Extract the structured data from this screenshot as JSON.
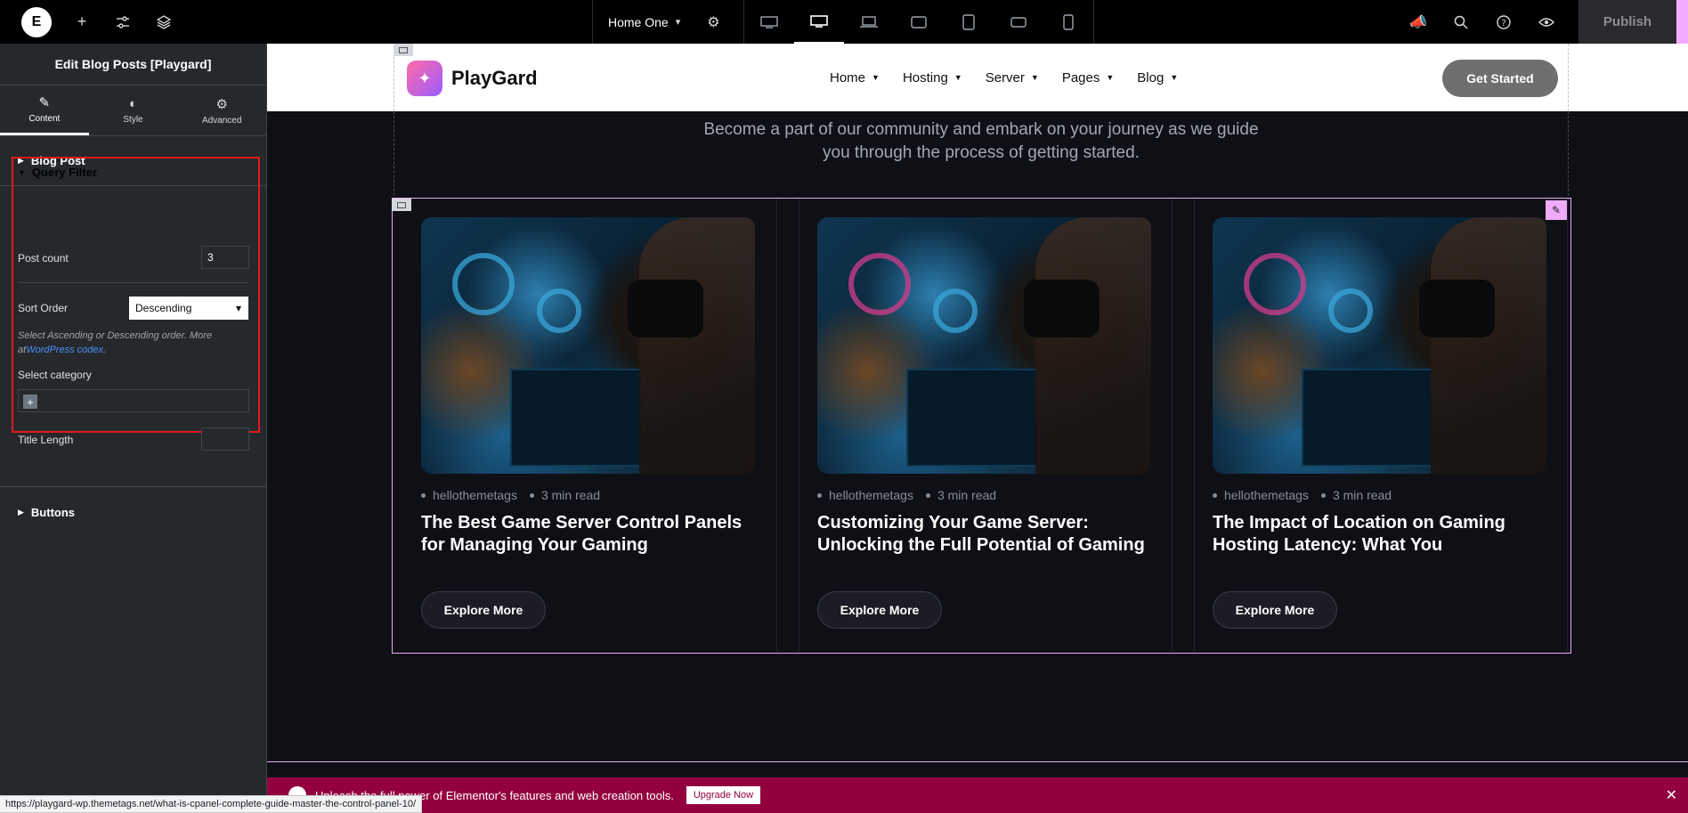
{
  "topbar": {
    "page_name": "Home One",
    "publish_label": "Publish",
    "devices": [
      "desktop",
      "tablet-landscape",
      "laptop",
      "tablet-wide",
      "tablet",
      "mobile-landscape",
      "mobile"
    ]
  },
  "sidebar": {
    "title": "Edit Blog Posts [Playgard]",
    "tabs": [
      {
        "label": "Content",
        "icon": "pencil-icon"
      },
      {
        "label": "Style",
        "icon": "half-circle-icon"
      },
      {
        "label": "Advanced",
        "icon": "gear-icon"
      }
    ],
    "sections": {
      "blog_post": "Blog Post",
      "query_filter": "Query Filter",
      "buttons": "Buttons"
    },
    "controls": {
      "post_count_label": "Post count",
      "post_count_value": "3",
      "sort_order_label": "Sort Order",
      "sort_order_value": "Descending",
      "helper_text": "Select Ascending or Descending order. More at",
      "helper_link": "WordPress codex",
      "helper_tail": ".",
      "category_label": "Select category",
      "title_length_label": "Title Length",
      "title_length_value": ""
    }
  },
  "site": {
    "brand": "PlayGard",
    "nav": [
      "Home",
      "Hosting",
      "Server",
      "Pages",
      "Blog"
    ],
    "cta": "Get Started",
    "intro_line1": "Become a part of our community and embark on your journey as we guide",
    "intro_line2": "you through the process of getting started."
  },
  "posts": [
    {
      "author": "hellothemetags",
      "read_time": "3 min read",
      "title": "The Best Game Server Control Panels for Managing Your Gaming",
      "button": "Explore More"
    },
    {
      "author": "hellothemetags",
      "read_time": "3 min read",
      "title": "Customizing Your Game Server: Unlocking the Full Potential of Gaming",
      "button": "Explore More"
    },
    {
      "author": "hellothemetags",
      "read_time": "3 min read",
      "title": "The Impact of Location on Gaming Hosting Latency: What You",
      "button": "Explore More"
    }
  ],
  "promo": {
    "text": "Unleash the full power of Elementor's features and web creation tools.",
    "button": "Upgrade Now"
  },
  "status_url": "https://playgard-wp.themetags.net/what-is-cpanel-complete-guide-master-the-control-panel-10/",
  "colors": {
    "accent": "#f0abfc",
    "highlight_box": "#e21a1a",
    "promo_bg": "#93003f",
    "canvas_bg": "#0f1016"
  }
}
